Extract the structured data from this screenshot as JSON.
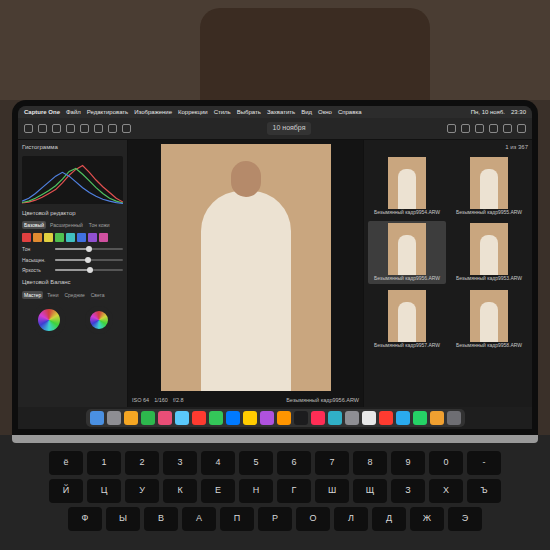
{
  "menubar": {
    "app": "Capture One",
    "items": [
      "Файл",
      "Редактировать",
      "Изображение",
      "Коррекции",
      "Стиль",
      "Выбрать",
      "Захватить",
      "Вид",
      "Окно",
      "Справка"
    ],
    "status": [
      "Пн, 10 нояб.",
      "23:30"
    ]
  },
  "window": {
    "title": "10 ноября"
  },
  "histogram": {
    "title": "Гистограмма",
    "series": [
      {
        "name": "R",
        "color": "#e05050",
        "values": [
          2,
          4,
          8,
          14,
          22,
          30,
          44,
          60,
          72,
          80,
          66,
          50,
          36,
          24,
          12,
          4
        ]
      },
      {
        "name": "G",
        "color": "#50c060",
        "values": [
          3,
          6,
          12,
          20,
          28,
          38,
          52,
          68,
          74,
          62,
          48,
          34,
          22,
          12,
          6,
          2
        ]
      },
      {
        "name": "B",
        "color": "#5080e0",
        "values": [
          6,
          12,
          22,
          34,
          46,
          58,
          66,
          58,
          46,
          34,
          24,
          16,
          10,
          6,
          3,
          1
        ]
      }
    ]
  },
  "color_editor": {
    "title": "Цветовой редактор",
    "tabs": [
      {
        "label": "Базовый",
        "selected": true
      },
      {
        "label": "Расширенный",
        "selected": false
      },
      {
        "label": "Тон кожи",
        "selected": false
      }
    ],
    "swatches": [
      {
        "color": "#e04040"
      },
      {
        "color": "#e08a30"
      },
      {
        "color": "#e0d040"
      },
      {
        "color": "#50c050"
      },
      {
        "color": "#40c0c0"
      },
      {
        "color": "#4070e0"
      },
      {
        "color": "#9050d0"
      },
      {
        "color": "#d050a0"
      }
    ],
    "sliders": [
      {
        "label": "Тон",
        "level": 0.5
      },
      {
        "label": "Насыщен.",
        "level": 0.48
      },
      {
        "label": "Яркость",
        "level": 0.52
      }
    ]
  },
  "color_balance": {
    "title": "Цветовой Баланс",
    "tabs": [
      {
        "label": "Мастер",
        "selected": true
      },
      {
        "label": "Тени",
        "selected": false
      },
      {
        "label": "Средние",
        "selected": false
      },
      {
        "label": "Света",
        "selected": false
      }
    ]
  },
  "viewer": {
    "info": [
      "ISO 64",
      "1/160",
      "f/2.8"
    ],
    "filename": "Безымянный кадр9956.ARW"
  },
  "filmstrip": {
    "count": "1 из 367",
    "items": [
      {
        "name": "Безымянный кадр9954.ARW",
        "selected": false
      },
      {
        "name": "Безымянный кадр9955.ARW",
        "selected": false
      },
      {
        "name": "Безымянный кадр9956.ARW",
        "selected": true
      },
      {
        "name": "Безымянный кадр9953.ARW",
        "selected": false
      },
      {
        "name": "Безымянный кадр9957.ARW",
        "selected": false
      },
      {
        "name": "Безымянный кадр9958.ARW",
        "selected": false
      }
    ]
  },
  "dock": [
    {
      "color": "#4a90e2"
    },
    {
      "color": "#8e8e93"
    },
    {
      "color": "#f5a623"
    },
    {
      "color": "#2db84d"
    },
    {
      "color": "#e94e77"
    },
    {
      "color": "#5ac8fa"
    },
    {
      "color": "#ff3b30"
    },
    {
      "color": "#34c759"
    },
    {
      "color": "#007aff"
    },
    {
      "color": "#ffcc00"
    },
    {
      "color": "#af52de"
    },
    {
      "color": "#ff9500"
    },
    {
      "color": "#1c1c1e"
    },
    {
      "color": "#ff2d55"
    },
    {
      "color": "#30b0c7"
    },
    {
      "color": "#8e8e93"
    },
    {
      "color": "#e8e8e8"
    },
    {
      "color": "#ff3b30"
    },
    {
      "color": "#2aabee"
    },
    {
      "color": "#25d366"
    },
    {
      "color": "#f0a030"
    },
    {
      "color": "#6e6e73"
    }
  ],
  "keyboard": [
    [
      "ё",
      "1",
      "2",
      "3",
      "4",
      "5",
      "6",
      "7",
      "8",
      "9",
      "0",
      "-"
    ],
    [
      "Й",
      "Ц",
      "У",
      "К",
      "Е",
      "Н",
      "Г",
      "Ш",
      "Щ",
      "З",
      "Х",
      "Ъ"
    ],
    [
      "Ф",
      "Ы",
      "В",
      "А",
      "П",
      "Р",
      "О",
      "Л",
      "Д",
      "Ж",
      "Э"
    ]
  ]
}
